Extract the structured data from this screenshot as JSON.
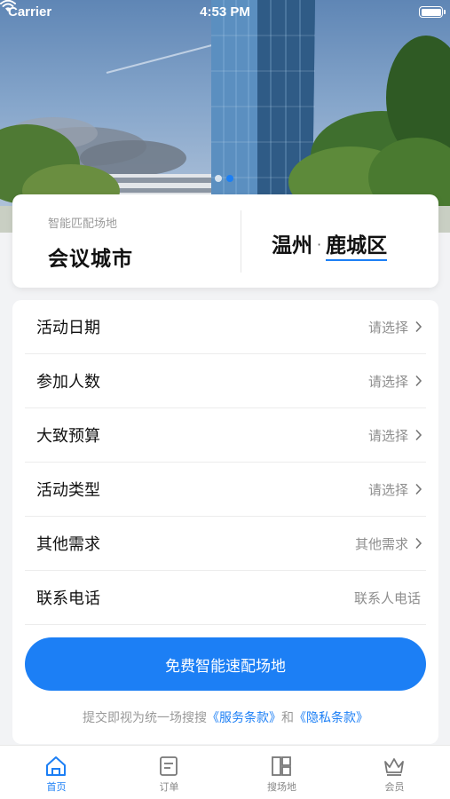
{
  "status_bar": {
    "carrier": "Carrier",
    "time": "4:53 PM"
  },
  "banner": {
    "dot_count": 2,
    "active_dot": 1
  },
  "venue_card": {
    "subtitle": "智能匹配场地",
    "venue_type": "会议城市",
    "city": "温州",
    "separator": "·",
    "district": "鹿城区"
  },
  "form": {
    "rows": [
      {
        "label": "活动日期",
        "value": "请选择"
      },
      {
        "label": "参加人数",
        "value": "请选择"
      },
      {
        "label": "大致预算",
        "value": "请选择"
      },
      {
        "label": "活动类型",
        "value": "请选择"
      },
      {
        "label": "其他需求",
        "value": "其他需求"
      },
      {
        "label": "联系电话",
        "placeholder": "联系人电话"
      }
    ],
    "submit_label": "免费智能速配场地",
    "terms": {
      "prefix": "提交即视为统一场搜搜",
      "service_link": "《服务条款》",
      "and": "和",
      "privacy_link": "《隐私条款》"
    }
  },
  "tabs": [
    {
      "label": "首页",
      "icon": "home-icon",
      "active": true
    },
    {
      "label": "订单",
      "icon": "order-icon",
      "active": false
    },
    {
      "label": "搜场地",
      "icon": "layout-icon",
      "active": false
    },
    {
      "label": "会员",
      "icon": "crown-icon",
      "active": false
    }
  ],
  "colors": {
    "accent": "#1c7ff5",
    "background": "#f2f3f5"
  }
}
